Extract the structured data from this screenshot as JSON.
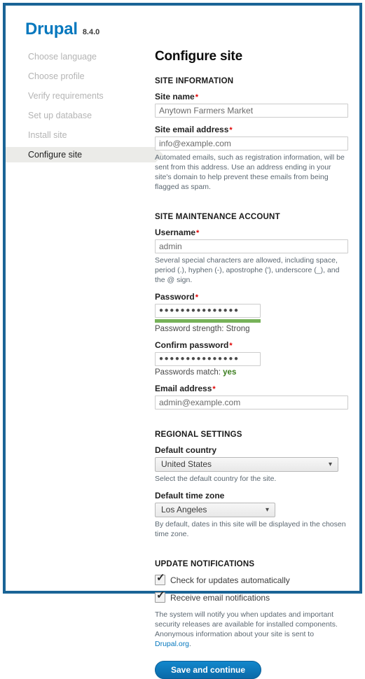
{
  "branding": {
    "name": "Drupal",
    "version": "8.4.0"
  },
  "tasks": [
    {
      "label": "Choose language",
      "active": false
    },
    {
      "label": "Choose profile",
      "active": false
    },
    {
      "label": "Verify requirements",
      "active": false
    },
    {
      "label": "Set up database",
      "active": false
    },
    {
      "label": "Install site",
      "active": false
    },
    {
      "label": "Configure site",
      "active": true
    }
  ],
  "page": {
    "title": "Configure site"
  },
  "site_information": {
    "section_title": "SITE INFORMATION",
    "site_name": {
      "label": "Site name",
      "required": "*",
      "value": "Anytown Farmers Market"
    },
    "site_email": {
      "label": "Site email address",
      "required": "*",
      "value": "info@example.com",
      "description": "Automated emails, such as registration information, will be sent from this address. Use an address ending in your site's domain to help prevent these emails from being flagged as spam."
    }
  },
  "maintenance_account": {
    "section_title": "SITE MAINTENANCE ACCOUNT",
    "username": {
      "label": "Username",
      "required": "*",
      "value": "admin",
      "description": "Several special characters are allowed, including space, period (.), hyphen (-), apostrophe ('), underscore (_), and the @ sign."
    },
    "password": {
      "label": "Password",
      "required": "*",
      "value": "●●●●●●●●●●●●●●●",
      "strength_label": "Password strength: Strong",
      "strength_percent": 100,
      "strength_color": "#77b259"
    },
    "confirm_password": {
      "label": "Confirm password",
      "required": "*",
      "value": "●●●●●●●●●●●●●●●",
      "match_prefix": "Passwords match: ",
      "match_value": "yes"
    },
    "email": {
      "label": "Email address",
      "required": "*",
      "value": "admin@example.com"
    }
  },
  "regional_settings": {
    "section_title": "REGIONAL SETTINGS",
    "country": {
      "label": "Default country",
      "value": "United States",
      "description": "Select the default country for the site."
    },
    "timezone": {
      "label": "Default time zone",
      "value": "Los Angeles",
      "description": "By default, dates in this site will be displayed in the chosen time zone."
    }
  },
  "update_notifications": {
    "section_title": "UPDATE NOTIFICATIONS",
    "check_updates": {
      "label": "Check for updates automatically",
      "checked": true
    },
    "email_notifications": {
      "label": "Receive email notifications",
      "checked": true
    },
    "description_before": "The system will notify you when updates and important security releases are available for installed components. Anonymous information about your site is sent to ",
    "description_link": "Drupal.org",
    "description_after": "."
  },
  "actions": {
    "submit_label": "Save and continue"
  },
  "colors": {
    "brand_blue": "#0678be",
    "frame_border": "#1a6496",
    "active_task_bg": "#ebebe8",
    "button_blue": "#0b6aa8",
    "strength_green": "#77b259",
    "required_red": "#e00000"
  }
}
